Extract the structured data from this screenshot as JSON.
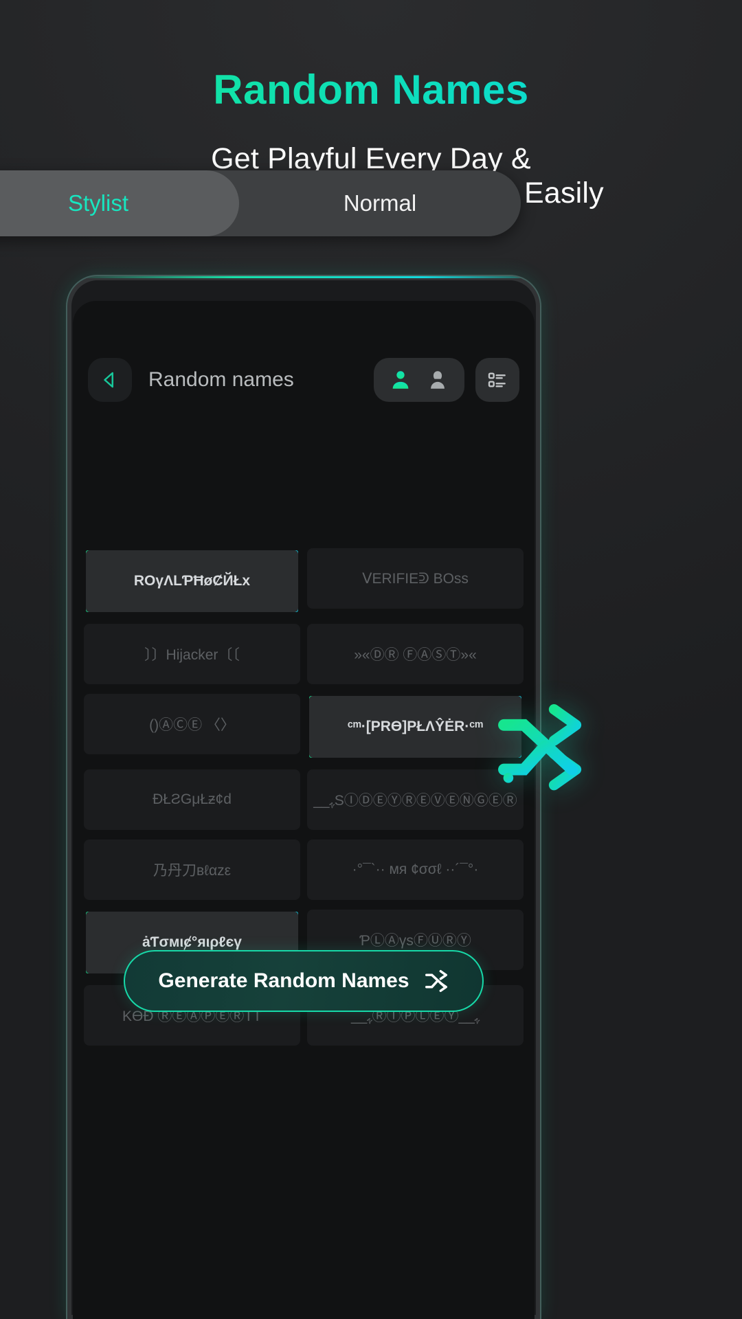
{
  "hero": {
    "title": "Random Names",
    "subtitle_line1": "Get Playful Every Day &",
    "subtitle_line2": "Explore Random Nicknames Easily",
    "title_gradient_start": "#16e58f",
    "title_gradient_end": "#09d6e4"
  },
  "appbar": {
    "back_label": "back",
    "title": "Random names",
    "male_icon": "person-male-icon",
    "female_icon": "person-female-icon",
    "male_selected_color": "#17e6a0",
    "female_color": "#a8acae",
    "list_icon": "list-view-icon"
  },
  "tabs": [
    {
      "label": "Stylist",
      "active": true
    },
    {
      "label": "Normal",
      "active": false
    }
  ],
  "names": [
    {
      "text": "ROγΛLƤĦøȻЙŁx",
      "selected": true,
      "tone": "bright"
    },
    {
      "text": "ᐯERIFIEᕲ  BOss",
      "selected": false,
      "tone": "dim"
    },
    {
      "text": "〕〕Hijacker〔〔",
      "selected": false,
      "tone": "dim"
    },
    {
      "text": "»«ⒹⓇ ⒻⒶⓈⓉ»«",
      "selected": false,
      "tone": "dim"
    },
    {
      "text": "()ⒶⒸⒺ 〈〉",
      "selected": false,
      "tone": "dim"
    },
    {
      "text": "ᶜᵐ·[PRӨ]PŁΛŶĖR·ᶜᵐ",
      "selected": true,
      "tone": "bright"
    },
    {
      "text": "ĐŁƧGμŁƶ¢d",
      "selected": false,
      "tone": "dim"
    },
    {
      "text": "__ﮩSⒾⒹⒺⓎⓇⒺⓋⒺⓃⒼⒺⓇ",
      "selected": false,
      "tone": "dim"
    },
    {
      "text": "乃丹刀вℓαzε",
      "selected": false,
      "tone": "dim"
    },
    {
      "text": "·°¯`·· мя ¢σσℓ ··´¯°·",
      "selected": false,
      "tone": "dim"
    },
    {
      "text": "ȧƬσмιȼ°яιρℓєγ",
      "selected": true,
      "tone": "bright"
    },
    {
      "text": "ƤⓁⒶγsⒻⓊⓇⓎ",
      "selected": false,
      "tone": "dim"
    },
    {
      "text": "KӨƉ ⓇⒺⒶⓅⒺⓇTT",
      "selected": false,
      "tone": "dim"
    },
    {
      "text": "__ﮩⓇⒾⓅⓁⒺⓎ__ﮩ",
      "selected": false,
      "tone": "dim"
    }
  ],
  "generate_button": {
    "label": "Generate Random Names",
    "icon": "shuffle-icon",
    "accent": "#17d9a8"
  },
  "floating_shuffle": {
    "icon": "shuffle-icon",
    "color_start": "#16e58f",
    "color_end": "#0fcfe8"
  }
}
